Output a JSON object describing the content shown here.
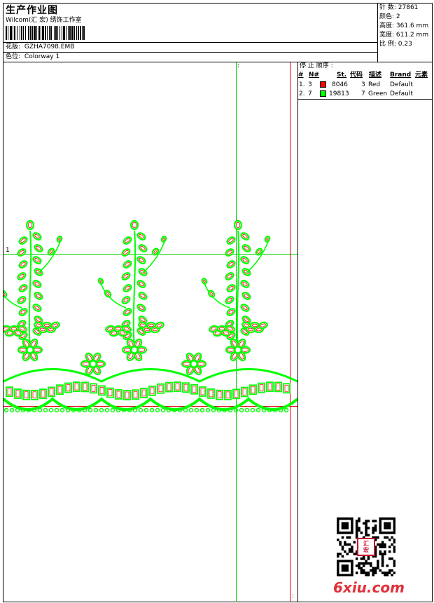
{
  "header": {
    "title": "生产作业图",
    "subtitle": "Wilcom(汇 宏) 绣饰工作室",
    "design_label": "花版:",
    "design_file": "GZHA7098.EMB",
    "colorway_label": "色位:",
    "colorway_value": "Colorway 1"
  },
  "stats": {
    "stitches_label": "针 数:",
    "stitches": "27861",
    "colors_label": "颜色:",
    "colors": "2",
    "height_label": "高度:",
    "height": "361.6 mm",
    "width_label": "宽度:",
    "width": "611.2 mm",
    "scale_label": "比 例:",
    "scale": "0.23"
  },
  "stop_sequence": {
    "title": "停 止 顺序 :",
    "columns": [
      "#",
      "N#",
      "St.",
      "代码",
      "描述",
      "Brand",
      "元素"
    ],
    "rows": [
      {
        "index": "1.",
        "n": "3",
        "color": "#ff0000",
        "stitches": "8046",
        "code": "3",
        "desc": "Red",
        "brand": "Default"
      },
      {
        "index": "2.",
        "n": "7",
        "color": "#00ff00",
        "stitches": "19813",
        "code": "7",
        "desc": "Green",
        "brand": "Default"
      }
    ]
  },
  "canvas": {
    "top_marker": ":",
    "row_marker": "1",
    "bottom_marker": ":"
  },
  "watermark": {
    "site": "6xiu.com",
    "stamp_text": "汇宏"
  },
  "colors": {
    "guide_green": "#00cc00",
    "border_red": "#dd0000",
    "thread_red": "#ff0000",
    "thread_green": "#00ff00"
  }
}
